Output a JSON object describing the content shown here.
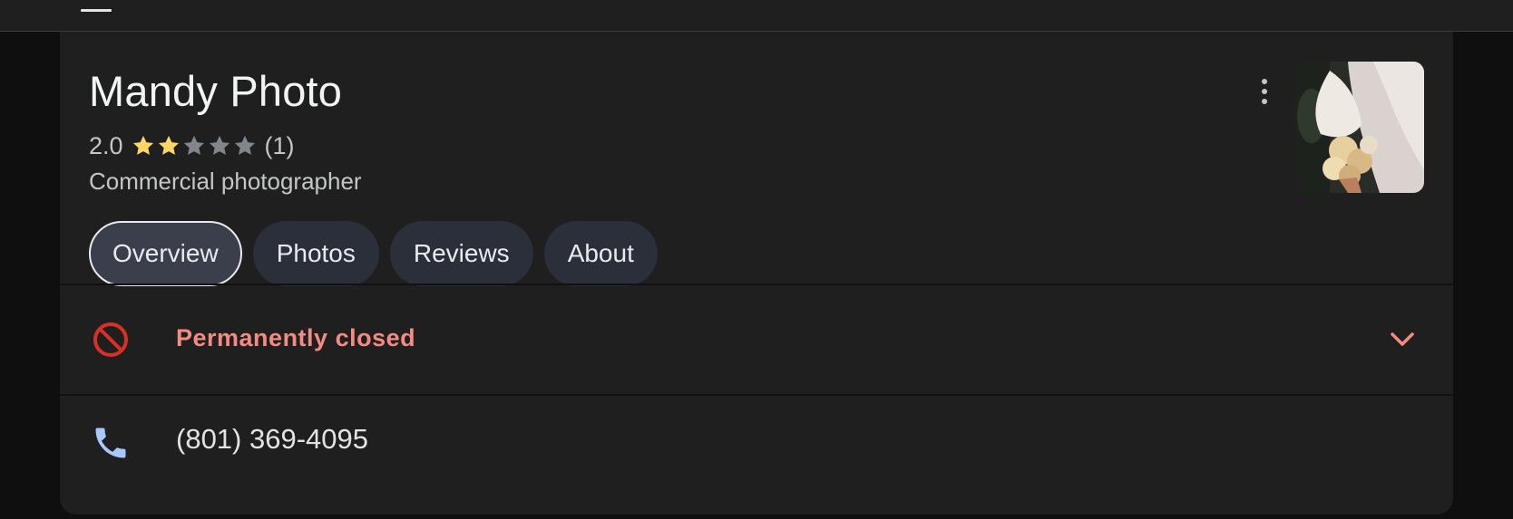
{
  "place": {
    "name": "Mandy Photo",
    "rating_value": "2.0",
    "rating": 2.0,
    "stars_max": 5,
    "review_count": "(1)",
    "category": "Commercial photographer"
  },
  "tabs": [
    {
      "label": "Overview",
      "active": true
    },
    {
      "label": "Photos",
      "active": false
    },
    {
      "label": "Reviews",
      "active": false
    },
    {
      "label": "About",
      "active": false
    }
  ],
  "status": {
    "label": "Permanently closed",
    "icon": "block-icon",
    "color": "#f28b82"
  },
  "phone": {
    "number": "(801) 369-4095",
    "icon": "phone-icon",
    "color": "#a8c7fa"
  },
  "colors": {
    "star_filled": "#fdd663",
    "star_empty": "#80868b",
    "closed_icon": "#d93025"
  }
}
